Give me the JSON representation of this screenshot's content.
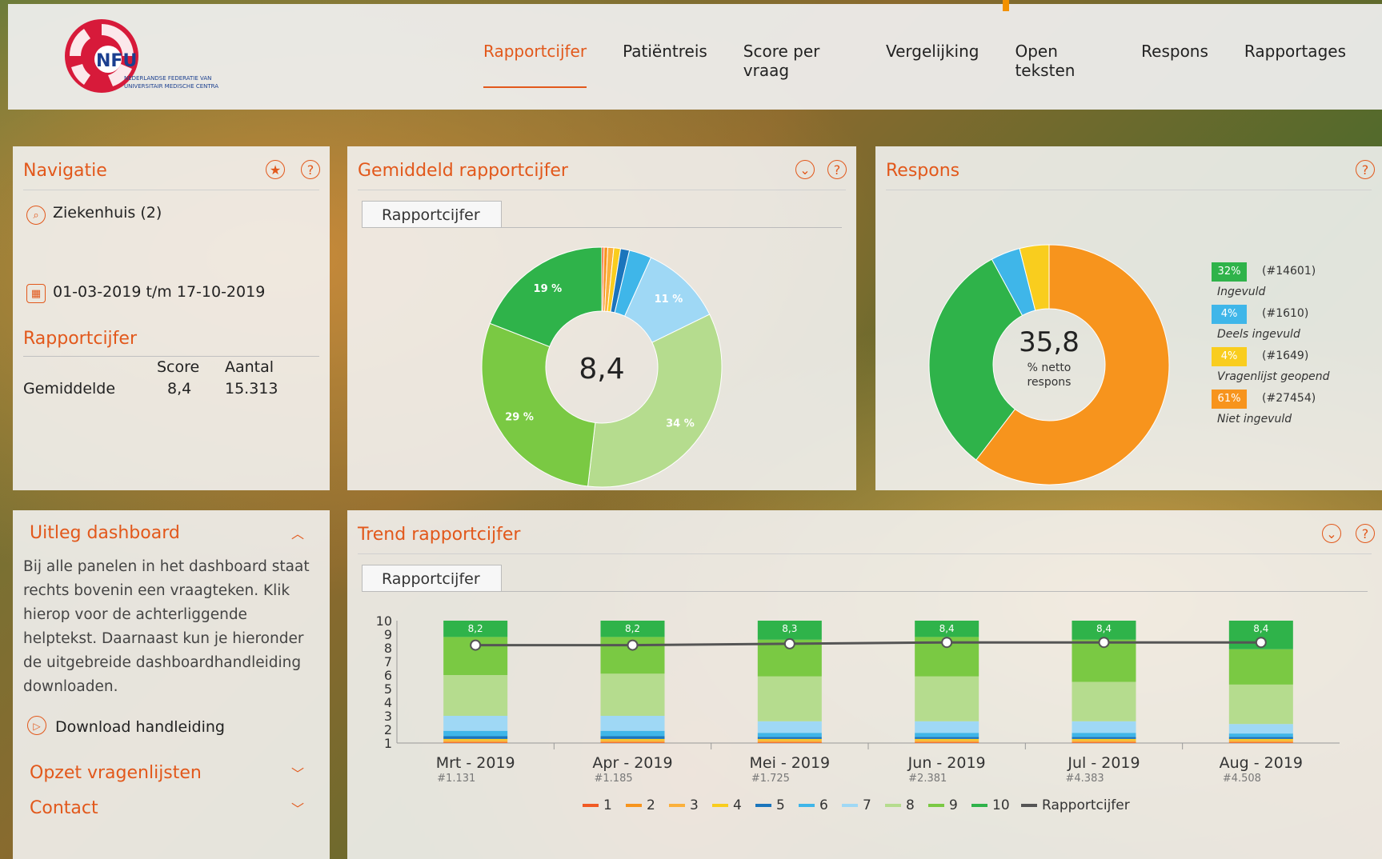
{
  "app": {
    "logo_text": "NFU",
    "logo_sub1": "NEDERLANDSE FEDERATIE VAN",
    "logo_sub2": "UNIVERSITAIR MEDISCHE CENTRA"
  },
  "nav": [
    "Rapportcijfer",
    "Patiëntreis",
    "Score per vraag",
    "Vergelijking",
    "Open teksten",
    "Respons",
    "Rapportages"
  ],
  "navigatie": {
    "title": "Navigatie",
    "location": "Ziekenhuis (2)",
    "period": "01-03-2019 t/m 17-10-2019",
    "section_title": "Rapportcijfer",
    "col_score": "Score",
    "col_aantal": "Aantal",
    "row_label": "Gemiddelde",
    "row_score": "8,4",
    "row_aantal": "15.313"
  },
  "gemiddeld": {
    "title": "Gemiddeld rapportcijfer",
    "tab": "Rapportcijfer",
    "center": "8,4"
  },
  "respons": {
    "title": "Respons",
    "center_value": "35,8",
    "center_l1": "% netto",
    "center_l2": "respons",
    "legend": [
      {
        "pct": "32%",
        "count": "(#14601)",
        "label": "Ingevuld",
        "color": "#2fb34a"
      },
      {
        "pct": "4%",
        "count": "(#1610)",
        "label": "Deels ingevuld",
        "color": "#3fb6e9"
      },
      {
        "pct": "4%",
        "count": "(#1649)",
        "label": "Vragenlijst geopend",
        "color": "#f9cd1e"
      },
      {
        "pct": "61%",
        "count": "(#27454)",
        "label": "Niet ingevuld",
        "color": "#f7941d"
      }
    ]
  },
  "uitleg": {
    "title": "Uitleg dashboard",
    "body": "Bij alle panelen in het dashboard staat rechts bovenin een vraagteken. Klik hierop voor de achterliggende helptekst. Daarnaast kun je hieronder de uitgebreide dashboardhandleiding downloaden.",
    "download": "Download handleiding",
    "opzet": "Opzet vragenlijsten",
    "contact": "Contact"
  },
  "trend": {
    "title": "Trend rapportcijfer",
    "tab": "Rapportcijfer"
  },
  "chart_data": [
    {
      "type": "pie",
      "title": "Gemiddeld rapportcijfer",
      "categories": [
        "1",
        "2",
        "3",
        "4",
        "5",
        "6",
        "7",
        "8",
        "9",
        "10"
      ],
      "values": [
        0.3,
        0.5,
        0.8,
        0.9,
        1.2,
        3,
        11,
        34,
        29,
        19
      ],
      "data_labels": [
        "",
        "",
        "",
        "",
        "",
        "",
        "11 %",
        "34 %",
        "29 %",
        "19 %"
      ],
      "colors": [
        "#f15a24",
        "#f7941d",
        "#fbb03b",
        "#f9cd1e",
        "#1b75bc",
        "#3fb6e9",
        "#9fd8f5",
        "#b5dc8e",
        "#7ac943",
        "#2fb34a"
      ],
      "center_label": "8,4"
    },
    {
      "type": "pie",
      "title": "Respons",
      "categories": [
        "Ingevuld",
        "Deels ingevuld",
        "Vragenlijst geopend",
        "Niet ingevuld"
      ],
      "values": [
        32,
        4,
        4,
        61
      ],
      "colors": [
        "#2fb34a",
        "#3fb6e9",
        "#f9cd1e",
        "#f7941d"
      ],
      "center_label": "35,8"
    },
    {
      "type": "bar",
      "title": "Trend rapportcijfer",
      "categories": [
        "Mrt - 2019",
        "Apr - 2019",
        "Mei - 2019",
        "Jun - 2019",
        "Jul - 2019",
        "Aug - 2019"
      ],
      "counts": [
        "#1.131",
        "#1.185",
        "#1.725",
        "#2.381",
        "#4.383",
        "#4.508"
      ],
      "ylim": [
        1,
        10
      ],
      "yticks": [
        1,
        2,
        3,
        4,
        5,
        6,
        7,
        8,
        9,
        10
      ],
      "stack_colors": [
        "#f15a24",
        "#f7941d",
        "#fbb03b",
        "#f9cd1e",
        "#1b75bc",
        "#3fb6e9",
        "#9fd8f5",
        "#b5dc8e",
        "#7ac943",
        "#2fb34a"
      ],
      "stack_series": [
        "1",
        "2",
        "3",
        "4",
        "5",
        "6",
        "7",
        "8",
        "9",
        "10"
      ],
      "stack_boundaries": [
        [
          1.05,
          1.1,
          1.2,
          1.3,
          1.5,
          1.9,
          3.0,
          6.0,
          8.8,
          10
        ],
        [
          1.05,
          1.1,
          1.2,
          1.3,
          1.5,
          1.9,
          3.0,
          6.1,
          8.8,
          10
        ],
        [
          1.05,
          1.1,
          1.2,
          1.3,
          1.45,
          1.75,
          2.6,
          5.9,
          8.6,
          10
        ],
        [
          1.05,
          1.1,
          1.2,
          1.3,
          1.45,
          1.75,
          2.6,
          5.9,
          8.8,
          10
        ],
        [
          1.05,
          1.1,
          1.2,
          1.3,
          1.45,
          1.75,
          2.6,
          5.5,
          8.6,
          10
        ],
        [
          1.05,
          1.1,
          1.2,
          1.3,
          1.45,
          1.7,
          2.4,
          5.3,
          7.9,
          10
        ]
      ],
      "line_name": "Rapportcijfer",
      "line_values": [
        8.2,
        8.2,
        8.3,
        8.4,
        8.4,
        8.4
      ],
      "line_labels": [
        "8,2",
        "8,2",
        "8,3",
        "8,4",
        "8,4",
        "8,4"
      ],
      "legend": [
        "1",
        "2",
        "3",
        "4",
        "5",
        "6",
        "7",
        "8",
        "9",
        "10",
        "Rapportcijfer"
      ],
      "legend_colors": [
        "#f15a24",
        "#f7941d",
        "#fbb03b",
        "#f9cd1e",
        "#1b75bc",
        "#3fb6e9",
        "#9fd8f5",
        "#b5dc8e",
        "#7ac943",
        "#2fb34a",
        "#555555"
      ]
    }
  ]
}
